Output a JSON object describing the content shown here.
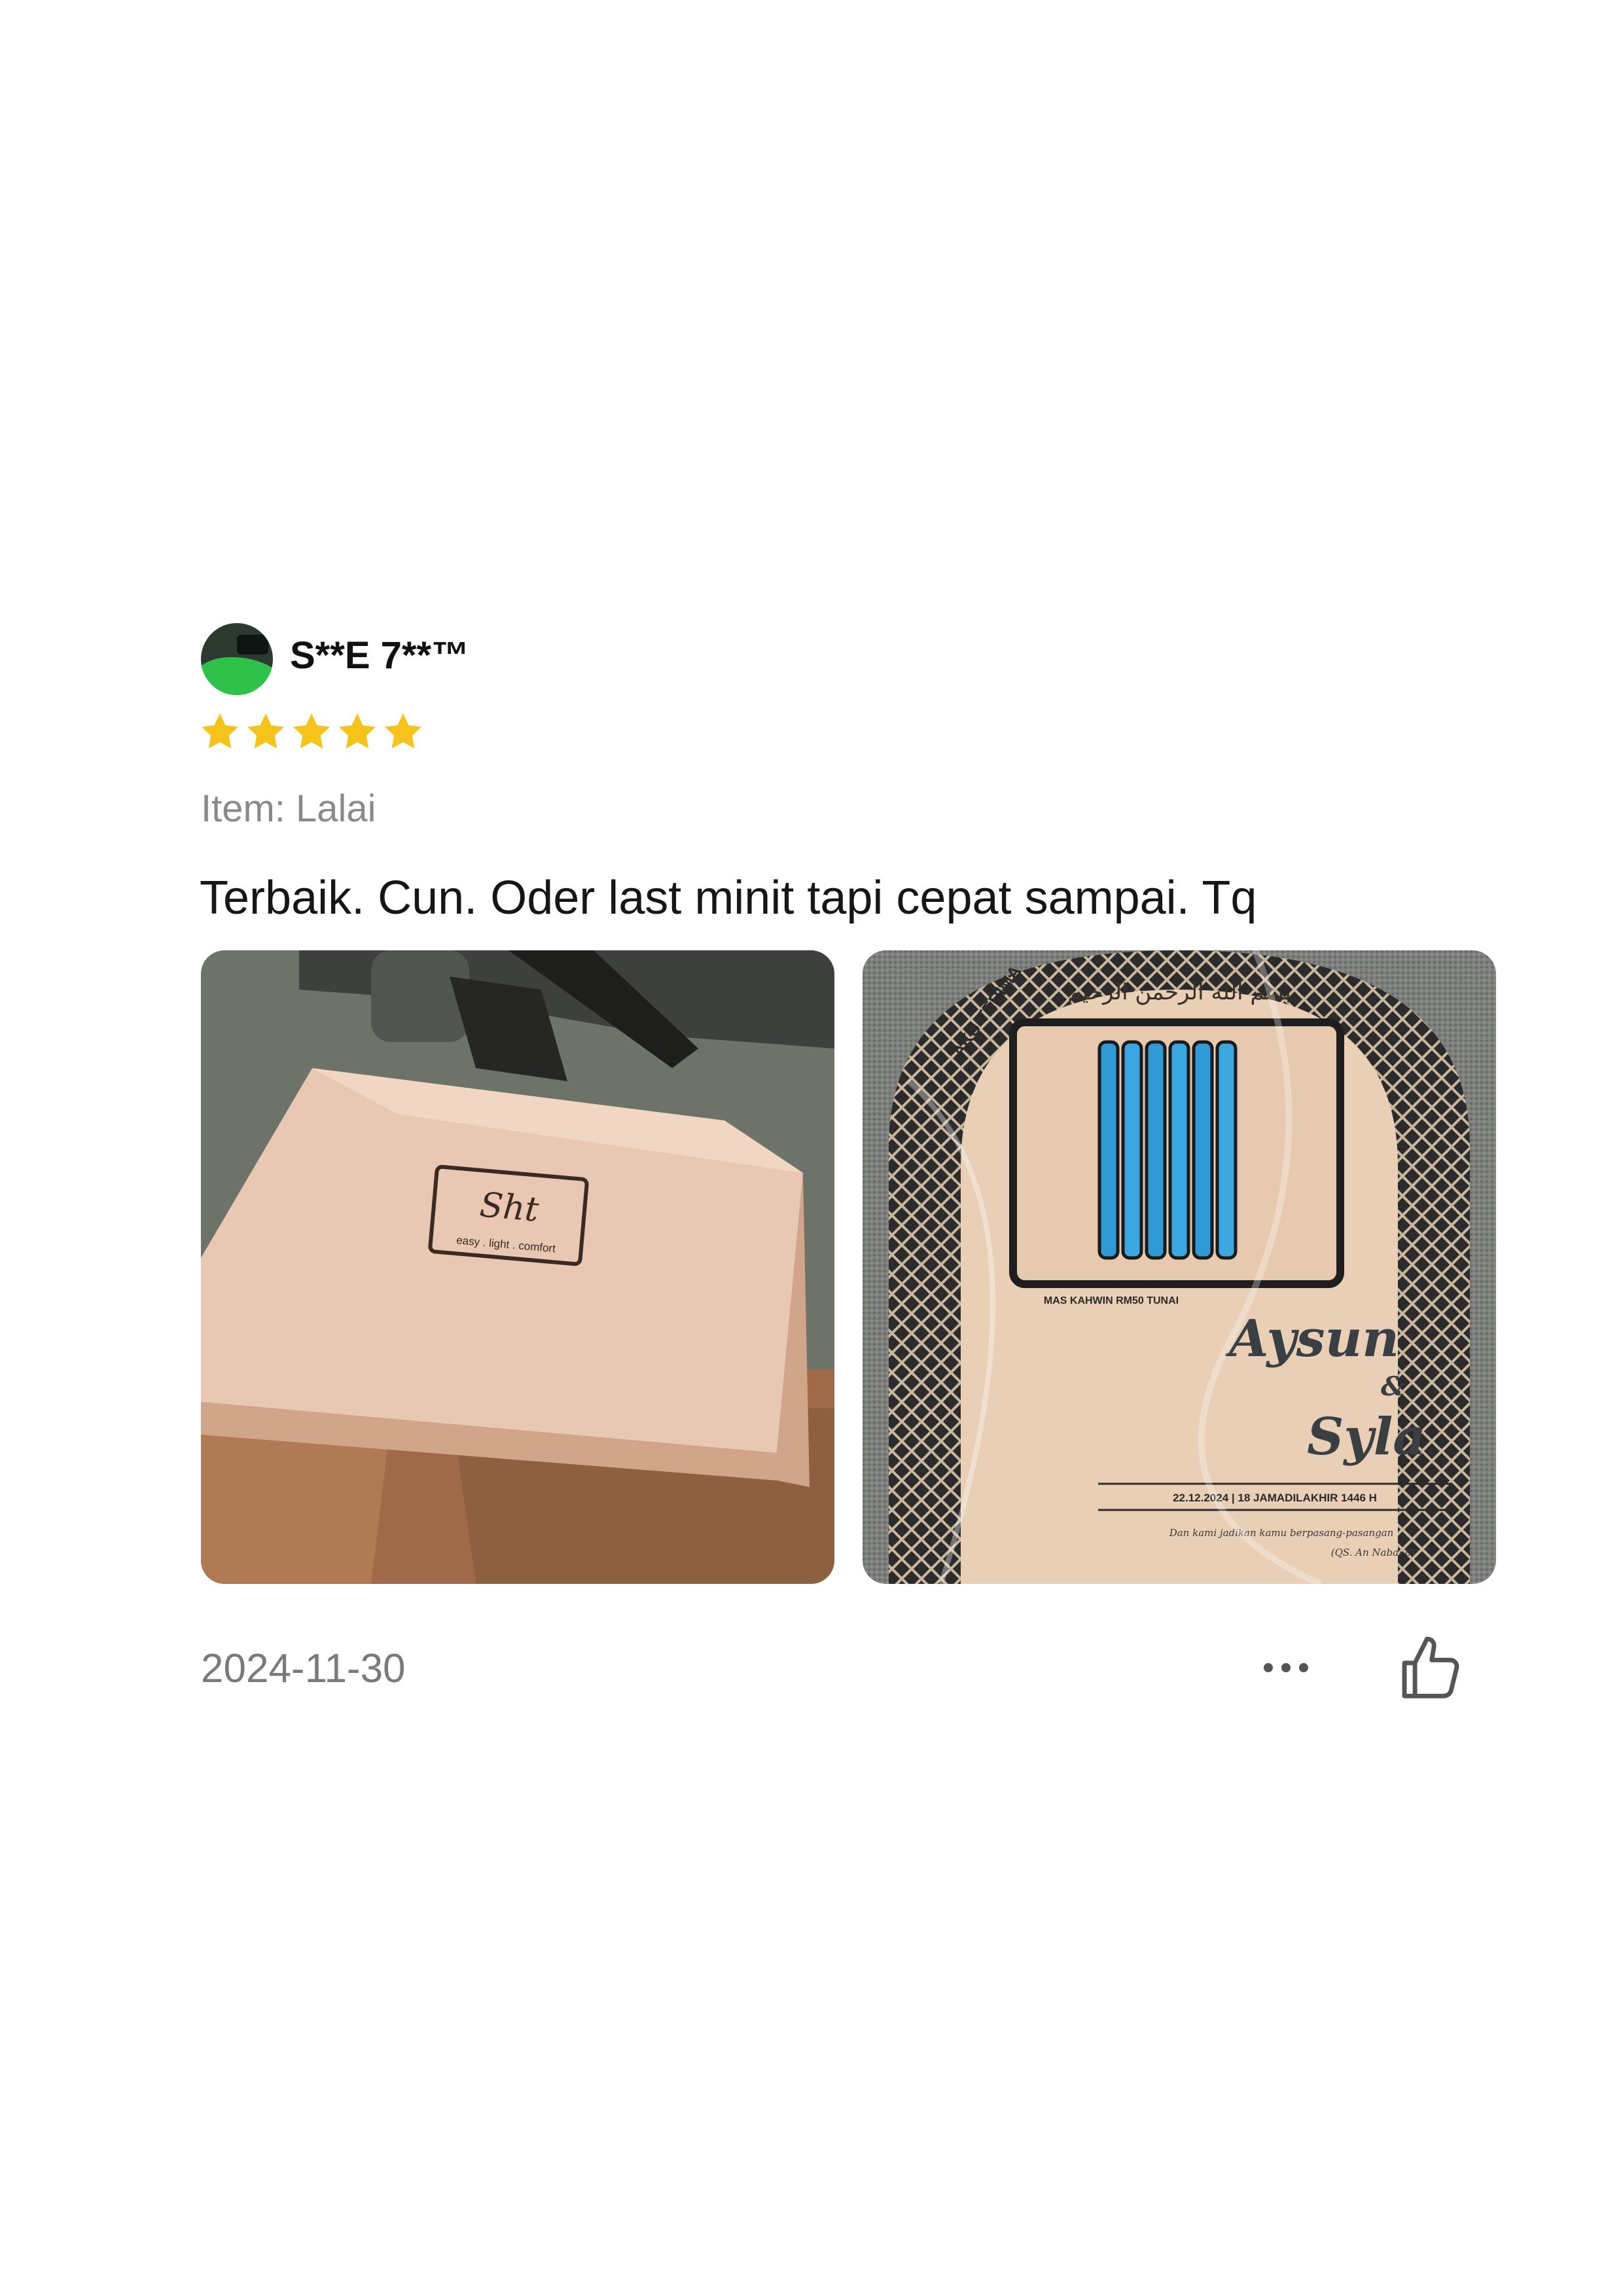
{
  "review": {
    "username": "S**E 7**™",
    "rating": 5,
    "rating_max": 5,
    "item": "Item: Lalai",
    "text": "Terbaik. Cun. Oder last minit tapi cepat sampai. Tq",
    "date": "2024-11-30"
  },
  "photos": {
    "box_logo_main": "Sht",
    "box_logo_tagline": "easy . light . comfort",
    "frame_header": "AKU TERIMA",
    "frame_calligraphy": "بسم الله الرحمن الرحيم",
    "frame_mas_kahwin": "MAS KAHWIN RM50 TUNAI",
    "frame_name_1": "Aysun",
    "frame_ampersand": "&",
    "frame_name_2": "Syla",
    "frame_date_line": "22.12.2024 | 18 JAMADILAKHIR 1446 H",
    "frame_verse": "Dan kami jadikan kamu berpasang-pasangan",
    "frame_verse_ref": "(QS. An Naba: 8)"
  },
  "colors": {
    "star": "#F6C31A",
    "text_primary": "#161616",
    "text_secondary": "#8a8a8a",
    "icon": "#555555"
  },
  "icons": {
    "avatar": "snooker-table-avatar",
    "star": "star-icon",
    "more": "more-dots-icon",
    "like": "thumbs-up-icon"
  }
}
